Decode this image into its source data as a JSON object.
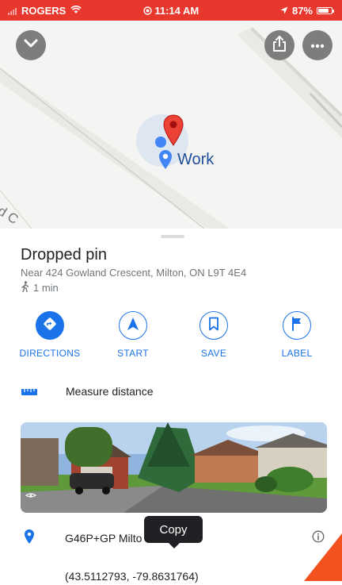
{
  "status_bar": {
    "carrier": "ROGERS",
    "time": "11:14 AM",
    "battery": "87%",
    "battery_level": 0.87
  },
  "map": {
    "saved_place_label": "Work",
    "street_label": "d C",
    "icons": {
      "collapse": "chevron-down-icon",
      "share": "share-icon",
      "more": "more-icon"
    }
  },
  "place": {
    "title": "Dropped pin",
    "address": "Near 424 Gowland Crescent, Milton, ON L9T 4E4",
    "walk_time": "1 min"
  },
  "actions": [
    {
      "label": "DIRECTIONS",
      "icon": "directions-icon"
    },
    {
      "label": "START",
      "icon": "navigation-arrow-icon"
    },
    {
      "label": "SAVE",
      "icon": "bookmark-icon"
    },
    {
      "label": "LABEL",
      "icon": "flag-icon"
    }
  ],
  "measure": {
    "label": "Measure distance"
  },
  "plus_code": {
    "value": "G46P+GP Milto"
  },
  "tooltip": {
    "label": "Copy"
  },
  "coordinates": {
    "value": "(43.5112793, -79.8631764)"
  },
  "colors": {
    "status_bar": "#e8372c",
    "accent": "#1a73e8",
    "pin_red": "#ea4335",
    "corner_orange": "#f4511e"
  }
}
